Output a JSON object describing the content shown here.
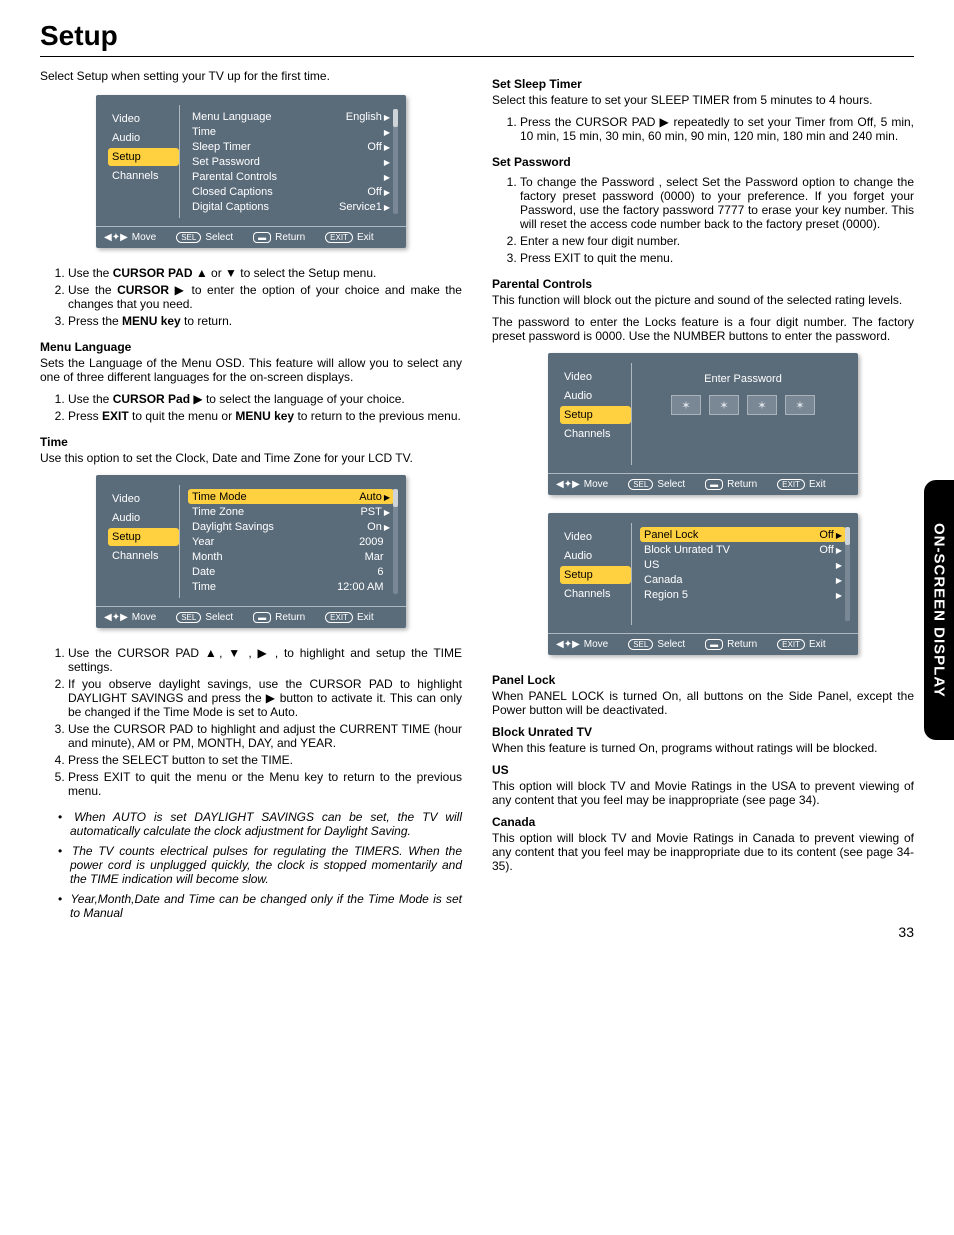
{
  "page_title": "Setup",
  "side_tab": "ON-SCREEN DISPLAY",
  "page_number": "33",
  "intro": "Select Setup when setting your TV up for the first time.",
  "osd_common": {
    "tabs": [
      "Video",
      "Audio",
      "Setup",
      "Channels"
    ],
    "foot_move": "Move",
    "foot_select": "Select",
    "foot_return": "Return",
    "foot_exit": "Exit",
    "sel_btn": "SEL",
    "exit_btn": "EXIT"
  },
  "osd1_rows": [
    {
      "label": "Menu Language",
      "val": "English",
      "arrow": true
    },
    {
      "label": "Time",
      "val": "",
      "arrow": true
    },
    {
      "label": "Sleep Timer",
      "val": "Off",
      "arrow": true
    },
    {
      "label": "Set Password",
      "val": "",
      "arrow": true
    },
    {
      "label": "Parental Controls",
      "val": "",
      "arrow": true
    },
    {
      "label": "Closed Captions",
      "val": "Off",
      "arrow": true
    },
    {
      "label": "Digital Captions",
      "val": "Service1",
      "arrow": true
    }
  ],
  "steps1": [
    "Use the <b>CURSOR PAD</b> ▲ or ▼ to select the Setup menu.",
    "Use the <b>CURSOR</b> ▶ to enter the option of your choice and make the changes that you need.",
    "Press the <b>MENU key</b> to return."
  ],
  "sec_menu_lang": {
    "head": "Menu Language",
    "body": "Sets the Language of the Menu OSD. This feature will allow you to select any one of three different languages for the on-screen displays.",
    "steps": [
      "Use the <b>CURSOR Pad</b> ▶ to select the language of your choice.",
      "Press <b>EXIT</b> to quit the menu or <b>MENU key</b> to return to the previous menu."
    ]
  },
  "sec_time": {
    "head": "Time",
    "body": "Use this option to set the Clock, Date and Time Zone for your LCD TV."
  },
  "osd2_rows": [
    {
      "label": "Time Mode",
      "val": "Auto",
      "arrow": true,
      "hl": true
    },
    {
      "label": "Time Zone",
      "val": "PST",
      "arrow": true
    },
    {
      "label": "Daylight Savings",
      "val": "On",
      "arrow": true
    },
    {
      "label": "Year",
      "val": "2009",
      "arrow": false
    },
    {
      "label": "Month",
      "val": "Mar",
      "arrow": false
    },
    {
      "label": "Date",
      "val": "6",
      "arrow": false
    },
    {
      "label": "Time",
      "val": "12:00 AM",
      "arrow": false
    }
  ],
  "steps_time": [
    "Use the CURSOR PAD ▲, ▼ , ▶ ,  to highlight and setup the TIME settings.",
    "If you observe daylight savings, use the CURSOR PAD to highlight DAYLIGHT SAVINGS and press the ▶ button to activate it. This can only be changed if the Time Mode is set to Auto.",
    "Use the CURSOR PAD to highlight and adjust the CURRENT TIME (hour and minute), AM or PM, MONTH, DAY, and YEAR.",
    "Press the SELECT button to set the TIME.",
    "Press EXIT to quit the menu or the Menu key to return to the previous menu."
  ],
  "bullets_time": [
    "When AUTO is set DAYLIGHT SAVINGS can be set, the TV will automatically calculate the clock adjustment for Daylight Saving.",
    "The TV counts electrical pulses for regulating the TIMERS. When the power cord is unplugged quickly, the clock is stopped momentarily and the TIME indication will become slow.",
    "Year,Month,Date and Time can be changed only if the Time Mode is set to Manual"
  ],
  "sec_sleep": {
    "head": "Set Sleep Timer",
    "body": "Select this feature to set your SLEEP TIMER from 5 minutes to 4 hours.",
    "steps": [
      "Press the CURSOR PAD ▶ repeatedly to set your Timer from Off, 5 min, 10 min, 15 min, 30 min, 60 min, 90 min, 120 min, 180 min and 240 min."
    ]
  },
  "sec_pwd": {
    "head": "Set Password",
    "steps": [
      "To change the Password , select Set the Password option to change the factory preset password (0000) to your preference. If you forget your Password, use the factory password 7777 to erase your key number. This will reset the access code number back to the factory preset (0000).",
      "Enter a new four digit number.",
      "Press EXIT to quit the menu."
    ]
  },
  "sec_parental": {
    "head": "Parental Controls",
    "body1": "This function will block out the picture and sound of the selected rating levels.",
    "body2": "The password to enter the Locks feature is a four digit number. The factory preset password is 0000. Use the NUMBER buttons to enter the password."
  },
  "osd3_title": "Enter Password",
  "osd3_star": "✶",
  "osd4_rows": [
    {
      "label": "Panel Lock",
      "val": "Off",
      "arrow": true,
      "hl": true
    },
    {
      "label": "Block Unrated TV",
      "val": "Off",
      "arrow": true
    },
    {
      "label": "US",
      "val": "",
      "arrow": true
    },
    {
      "label": "Canada",
      "val": "",
      "arrow": true
    },
    {
      "label": "Region 5",
      "val": "",
      "arrow": true
    }
  ],
  "sec_panel": {
    "head": "Panel Lock",
    "body": "When PANEL LOCK is turned On, all buttons on the Side Panel, except the Power button will be deactivated."
  },
  "sec_block": {
    "head": "Block Unrated TV",
    "body": "When this feature is turned On, programs without ratings will be blocked."
  },
  "sec_us": {
    "head": "US",
    "body": "This option will block TV and Movie Ratings in the USA  to prevent viewing of any content that you feel may be inappropriate (see page 34)."
  },
  "sec_ca": {
    "head": "Canada",
    "body": "This option will block TV and Movie Ratings in Canada to prevent viewing of any content that you feel may be inappropriate due to its content (see page 34-35)."
  }
}
